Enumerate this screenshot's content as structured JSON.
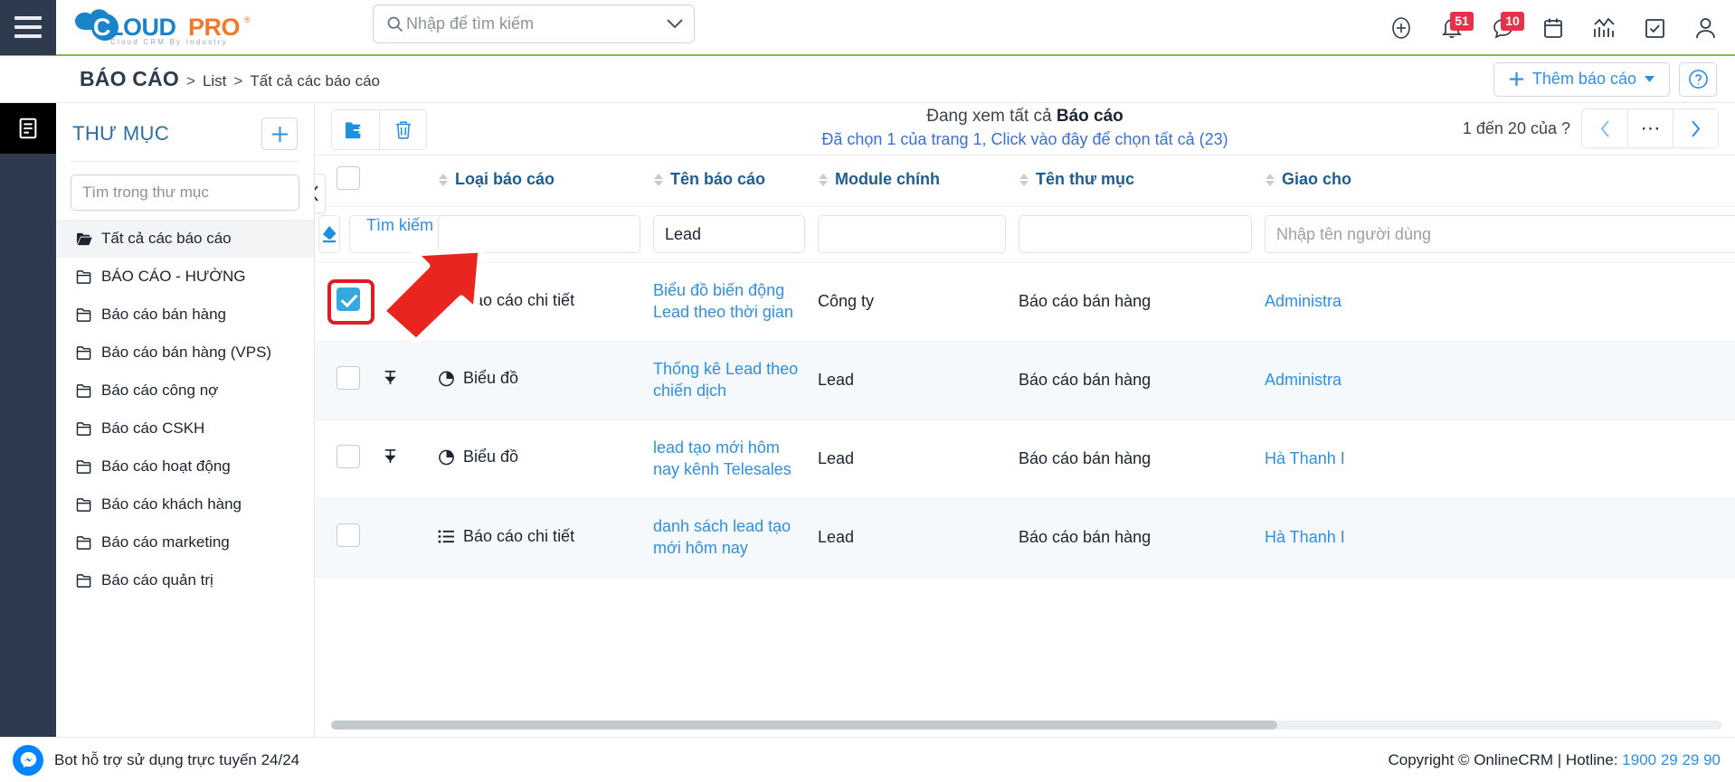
{
  "topbar": {
    "menu_icon": "hamburger-icon",
    "logo": {
      "text_cloud": "CLOUD",
      "text_pro": "PRO",
      "tagline": "Cloud CRM By Industry",
      "mark": "®"
    },
    "search": {
      "placeholder": "Nhập để tìm kiếm",
      "value": "",
      "icon": "search-icon",
      "dropdown_icon": "chevron-down-icon"
    },
    "icons": [
      {
        "name": "add-circle-icon",
        "badge": ""
      },
      {
        "name": "bell-icon",
        "badge": "51"
      },
      {
        "name": "chat-icon",
        "badge": "10"
      },
      {
        "name": "calendar-icon",
        "badge": ""
      },
      {
        "name": "analytics-icon",
        "badge": ""
      },
      {
        "name": "task-check-icon",
        "badge": ""
      },
      {
        "name": "user-account-icon",
        "badge": ""
      }
    ]
  },
  "breadcrumb": {
    "module": "BÁO CÁO",
    "sep": ">",
    "items": [
      "List",
      "Tất cả các báo cáo"
    ],
    "add_button": "Thêm báo cáo",
    "add_icon": "plus-icon",
    "add_caret": "caret-down-icon",
    "help_icon": "help-circle-icon"
  },
  "sidebar": {
    "title": "THƯ MỤC",
    "add_icon": "plus-icon",
    "search_placeholder": "Tìm trong thư mục",
    "search_value": "",
    "folders": [
      {
        "label": "Tất cả các báo cáo",
        "active": true
      },
      {
        "label": "BÁO CÁO - HƯỜNG",
        "active": false
      },
      {
        "label": "Báo cáo bán hàng",
        "active": false
      },
      {
        "label": "Báo cáo bán hàng (VPS)",
        "active": false
      },
      {
        "label": "Báo cáo công nợ",
        "active": false
      },
      {
        "label": "Báo cáo CSKH",
        "active": false
      },
      {
        "label": "Báo cáo hoạt động",
        "active": false
      },
      {
        "label": "Báo cáo khách hàng",
        "active": false
      },
      {
        "label": "Báo cáo marketing",
        "active": false
      },
      {
        "label": "Báo cáo quản trị",
        "active": false
      }
    ]
  },
  "panel": {
    "move_icon": "move-to-folder-icon",
    "delete_icon": "trash-icon",
    "viewing_prefix": "Đang xem tất cả ",
    "viewing_bold": "Báo cáo",
    "selection_text": "Đã chọn 1 của trang 1, Click vào đây để chọn tất cả (23)",
    "pagination_text": "1 đến 20 của ?",
    "prev_icon": "chevron-left-icon",
    "more_icon": "ellipsis-icon",
    "next_icon": "chevron-right-icon",
    "collapse_icon": "chevron-left-icon"
  },
  "table": {
    "columns": [
      {
        "key": "checkbox",
        "label": "",
        "sortable": false
      },
      {
        "key": "pin",
        "label": "",
        "sortable": false
      },
      {
        "key": "type",
        "label": "Loại báo cáo",
        "sortable": true
      },
      {
        "key": "name",
        "label": "Tên báo cáo",
        "sortable": true
      },
      {
        "key": "module",
        "label": "Module chính",
        "sortable": true
      },
      {
        "key": "folder",
        "label": "Tên thư mục",
        "sortable": true
      },
      {
        "key": "assigned",
        "label": "Giao cho",
        "sortable": true
      }
    ],
    "filters": {
      "clear_icon": "eraser-icon",
      "search_label": "Tìm kiếm",
      "type_value": "",
      "name_value": "Lead",
      "module_value": "",
      "folder_value": "",
      "assigned_placeholder": "Nhập tên người dùng"
    },
    "rows": [
      {
        "checked": true,
        "highlighted": true,
        "pin": false,
        "type_icon": "list-detail-icon",
        "type": "Báo cáo chi tiết",
        "name": "Biểu đồ biến động Lead theo thời gian",
        "module": "Công ty",
        "folder": "Báo cáo bán hàng",
        "assigned": "Administra"
      },
      {
        "checked": false,
        "highlighted": false,
        "pin": true,
        "type_icon": "chart-pie-icon",
        "type": "Biểu đồ",
        "name": "Thống kê Lead theo chiến dịch",
        "module": "Lead",
        "folder": "Báo cáo bán hàng",
        "assigned": "Administra"
      },
      {
        "checked": false,
        "highlighted": false,
        "pin": true,
        "type_icon": "chart-pie-icon",
        "type": "Biểu đồ",
        "name": "lead tạo mới hôm nay kênh Telesales",
        "module": "Lead",
        "folder": "Báo cáo bán hàng",
        "assigned": "Hà Thanh I"
      },
      {
        "checked": false,
        "highlighted": false,
        "pin": false,
        "type_icon": "list-detail-icon",
        "type": "Báo cáo chi tiết",
        "name": "danh sách lead tạo mới hôm nay",
        "module": "Lead",
        "folder": "Báo cáo bán hàng",
        "assigned": "Hà Thanh I"
      }
    ]
  },
  "footer": {
    "bot_icon": "messenger-icon",
    "bot_text": "Bot hỗ trợ sử dụng trực tuyến 24/24",
    "copyright": "Copyright © OnlineCRM | Hotline: ",
    "hotline": "1900 29 29 90"
  },
  "colors": {
    "brand_blue": "#1b83c9",
    "brand_orange": "#f07a27",
    "accent_green": "#7cc242",
    "link_blue": "#2f8fe0",
    "badge_red": "#e8304a",
    "dark_navy": "#2e3b4e",
    "annotation_red": "#e01b24"
  }
}
